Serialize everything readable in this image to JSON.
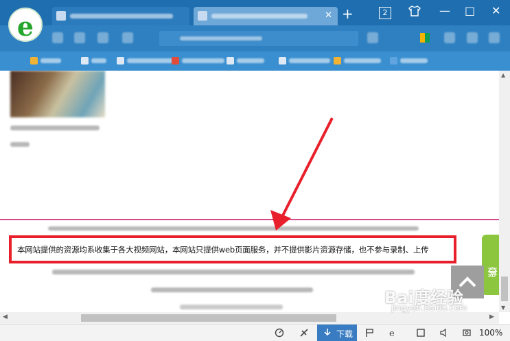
{
  "browser": {
    "tab_count": "2",
    "new_tab_icon": "+",
    "shirt_icon": "skin-icon",
    "minimize": "—",
    "maximize": "□",
    "close": "✕"
  },
  "content": {
    "notice": "本网站提供的资源均系收集于各大视频网站，本网站只提供web页面服务，并不提供影片资源存储，也不参与录制、上传"
  },
  "share": {
    "label_1": "分",
    "label_2": "享"
  },
  "statusbar": {
    "download_label": "下载",
    "zoom": "100%"
  },
  "colors": {
    "titlebar": "#1f6fb0",
    "highlight_border": "#e8202b",
    "arrow": "#e8202b",
    "share": "#8cc63f"
  },
  "watermark": {
    "brand": "Bai度经验",
    "url": "jingyan.baidu.com"
  }
}
